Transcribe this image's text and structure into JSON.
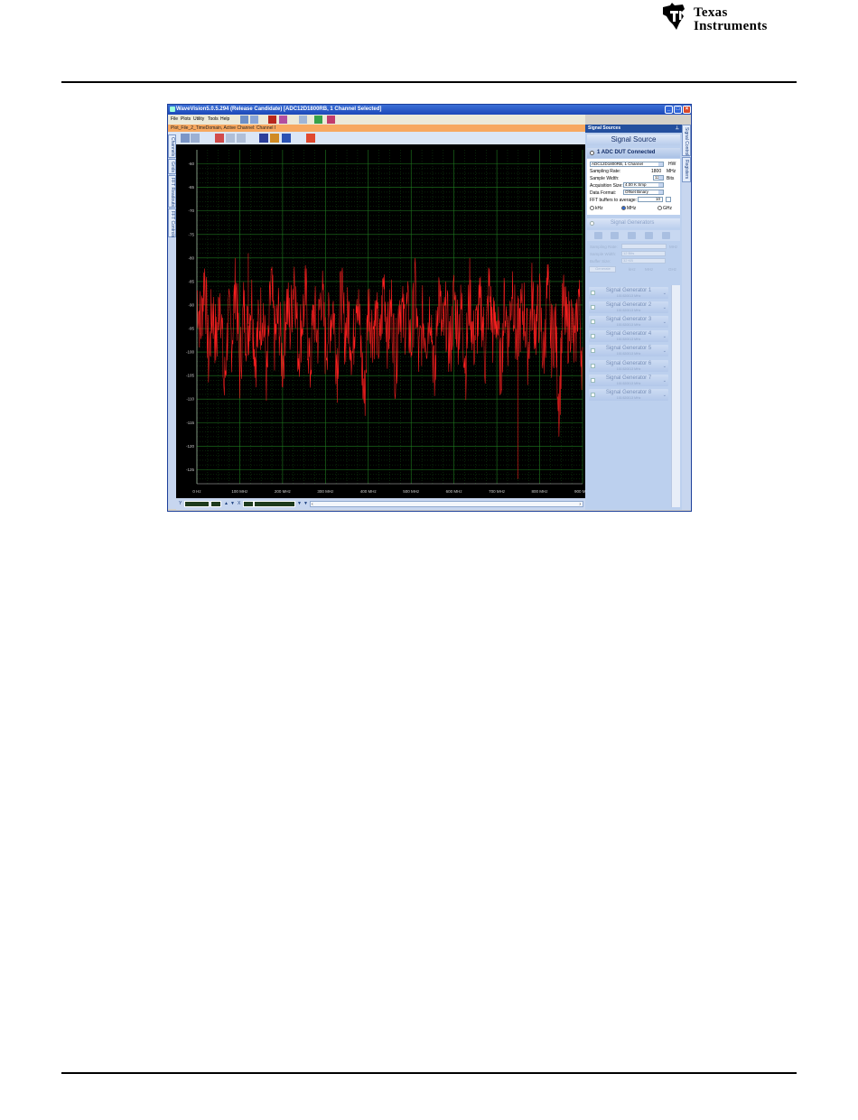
{
  "header": {
    "logo_line1": "Texas",
    "logo_line2": "Instruments"
  },
  "window": {
    "title": "WaveVision5.0.5.294 (Release Candidate)  [ADC12D1800RB, 1 Channel Selected]",
    "menu": [
      "File",
      "Plots",
      "Utility",
      "Tools",
      "Help"
    ],
    "doc_title": "Plot_File_2_TimeDomain, Active Channel: Channel I",
    "left_tabs": [
      "Channels",
      "Grids",
      "FFT Readouts",
      "FFT Controls"
    ],
    "right_tabs": [
      "Signal Control",
      "Registers"
    ]
  },
  "plot": {
    "y_ticks": [
      "-60",
      "-65",
      "-70",
      "-75",
      "-80",
      "-85",
      "-90",
      "-95",
      "-100",
      "-105",
      "-110",
      "-115",
      "-120",
      "-125"
    ],
    "x_ticks": [
      "0 Hz",
      "100 MHz",
      "200 MHz",
      "300 MHz",
      "400 MHz",
      "500 MHz",
      "600 MHz",
      "700 MHz",
      "800 MHz",
      "900 MHz"
    ],
    "colors": {
      "background": "#000000",
      "grid": "#1f7a1f",
      "trace": "#ff2020",
      "marker": "#b01414"
    }
  },
  "chart_data": {
    "type": "line",
    "title": "",
    "xlabel": "",
    "ylabel": "",
    "xlim": [
      0,
      900
    ],
    "ylim": [
      -128,
      -57
    ],
    "x_unit": "MHz",
    "trace": "FFT noise floor, values mostly between -85 and -105, occasional spurs to -80 and dips to -115",
    "series": [
      {
        "values": [
          -87,
          -95,
          -83,
          -102,
          -90,
          -99,
          -86,
          -109,
          -93,
          -97,
          -84,
          -104,
          -91,
          -96,
          -88,
          -101,
          -94,
          -90,
          -107,
          -85,
          -98,
          -92,
          -103,
          -89,
          -95,
          -82,
          -100,
          -93,
          -88,
          -105,
          -91,
          -97,
          -86,
          -99,
          -94,
          -90,
          -103,
          -87,
          -96,
          -92,
          -101,
          -85,
          -98,
          -111,
          -89,
          -95,
          -93,
          -100,
          -84,
          -97,
          -90,
          -104,
          -88,
          -94,
          -91,
          -99,
          -86,
          -102,
          -93,
          -96,
          -89,
          -108,
          -85,
          -97,
          -92,
          -100,
          -88,
          -95,
          -91,
          -103,
          -87,
          -98,
          -94,
          -90,
          -101,
          -86,
          -96,
          -92,
          -105,
          -89,
          -97,
          -84,
          -99,
          -93,
          -91,
          -100,
          -88,
          -95,
          -90,
          -102,
          -86,
          -98,
          -94,
          -112,
          -89,
          -96,
          -92,
          -100,
          -87,
          -104
        ]
      }
    ]
  },
  "bottombar": {
    "y_label": "Y",
    "x_label": "X"
  },
  "signal_panel": {
    "header": "Signal Sources",
    "title": "Signal Source",
    "dut_label": "1 ADC DUT Connected",
    "device": "ADC12D1800RB, 1 Channel",
    "device_unit": "HW",
    "sampling_rate_label": "Sampling Rate:",
    "sampling_rate_value": "1800",
    "sampling_rate_unit": "MHz",
    "sample_width_label": "Sample Width:",
    "sample_width_value": "12",
    "sample_width_unit": "Bits",
    "acq_size_label": "Acquisition Size:",
    "acq_size_value": "4.00 K Smp",
    "data_format_label": "Data Format:",
    "data_format_value": "Offset Binary",
    "fft_buffers_label": "FFT buffers to average:",
    "fft_buffers_value": "10",
    "freq_units": [
      "kHz",
      "MHz",
      "GHz"
    ],
    "sg_header": "Signal Generators",
    "sg_rows": [
      {
        "label": "Sampling Rate:",
        "value": "",
        "unit": "MHz"
      },
      {
        "label": "Sample Width:",
        "value": "12 Bits",
        "unit": ""
      },
      {
        "label": "Buffer Size:",
        "value": "32 KB",
        "unit": ""
      }
    ],
    "sg_generate": "Generate",
    "sg_units": [
      "kHz",
      "MHz",
      "GHz"
    ],
    "generators": [
      {
        "name": "Signal Generator 1",
        "sub": "100.520013 MHz"
      },
      {
        "name": "Signal Generator 2",
        "sub": "100.520013 MHz"
      },
      {
        "name": "Signal Generator 3",
        "sub": "100.520013 MHz"
      },
      {
        "name": "Signal Generator 4",
        "sub": "100.520013 MHz"
      },
      {
        "name": "Signal Generator 5",
        "sub": "100.520013 MHz"
      },
      {
        "name": "Signal Generator 6",
        "sub": "100.520013 MHz"
      },
      {
        "name": "Signal Generator 7",
        "sub": "100.520013 MHz"
      },
      {
        "name": "Signal Generator 8",
        "sub": "100.520013 MHz"
      }
    ]
  }
}
